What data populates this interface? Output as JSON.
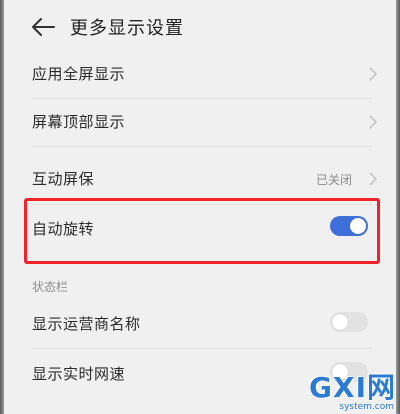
{
  "header": {
    "title": "更多显示设置",
    "back_icon": "back-arrow-icon"
  },
  "rows": [
    {
      "label": "应用全屏显示",
      "chevron": true
    },
    {
      "label": "屏幕顶部显示",
      "chevron": true
    },
    {
      "label": "互动屏保",
      "value": "已关闭",
      "chevron": true
    },
    {
      "label": "自动旋转",
      "toggle": "on"
    }
  ],
  "status_bar_section": {
    "label": "状态栏",
    "rows": [
      {
        "label": "显示运营商名称",
        "toggle": "off"
      },
      {
        "label": "显示实时网速",
        "toggle": "off"
      }
    ]
  },
  "watermark": {
    "main": "GXI网",
    "sub": "system.com"
  },
  "colors": {
    "accent": "#3f6fd8",
    "highlight": "#f0232a",
    "background": "#f0f0f0",
    "watermark": "#2b7bd3"
  }
}
